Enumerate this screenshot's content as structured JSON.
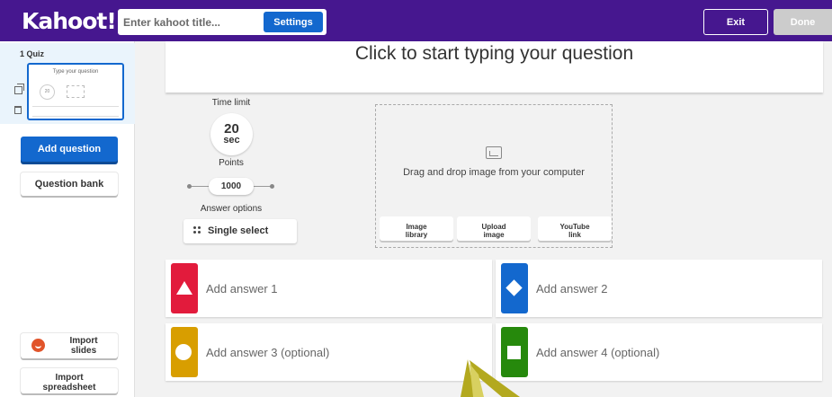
{
  "header": {
    "logo": "Kahoot!",
    "title_placeholder": "Enter kahoot title...",
    "settings_label": "Settings",
    "exit_label": "Exit",
    "done_label": "Done"
  },
  "sidebar": {
    "slide_label": "1  Quiz",
    "thumb_title": "Type your question",
    "thumb_time": "20",
    "add_question": "Add question",
    "question_bank": "Question bank",
    "import_slides": "Import\nslides",
    "import_spreadsheet": "Import\nspreadsheet"
  },
  "question": {
    "placeholder": "Click to start typing your question"
  },
  "settings": {
    "time_limit_label": "Time limit",
    "time_value": "20",
    "time_unit": "sec",
    "points_label": "Points",
    "points_value": "1000",
    "answer_options_label": "Answer options",
    "answer_type": "Single select"
  },
  "media": {
    "drag_text": "Drag and drop image from your computer",
    "buttons": [
      "Image\nlibrary",
      "Upload\nimage",
      "YouTube\nlink"
    ]
  },
  "answers": [
    {
      "text": "Add answer 1",
      "color": "#e21b3c",
      "shape": "triangle-icon"
    },
    {
      "text": "Add answer 2",
      "color": "#1368ce",
      "shape": "diamond-icon"
    },
    {
      "text": "Add answer 3 (optional)",
      "color": "#d89e00",
      "shape": "circle-icon"
    },
    {
      "text": "Add answer 4 (optional)",
      "color": "#26890c",
      "shape": "square-icon"
    }
  ],
  "colors": {
    "brand": "#46178f",
    "primary": "#1368ce",
    "cursor": "#b3a91f"
  }
}
